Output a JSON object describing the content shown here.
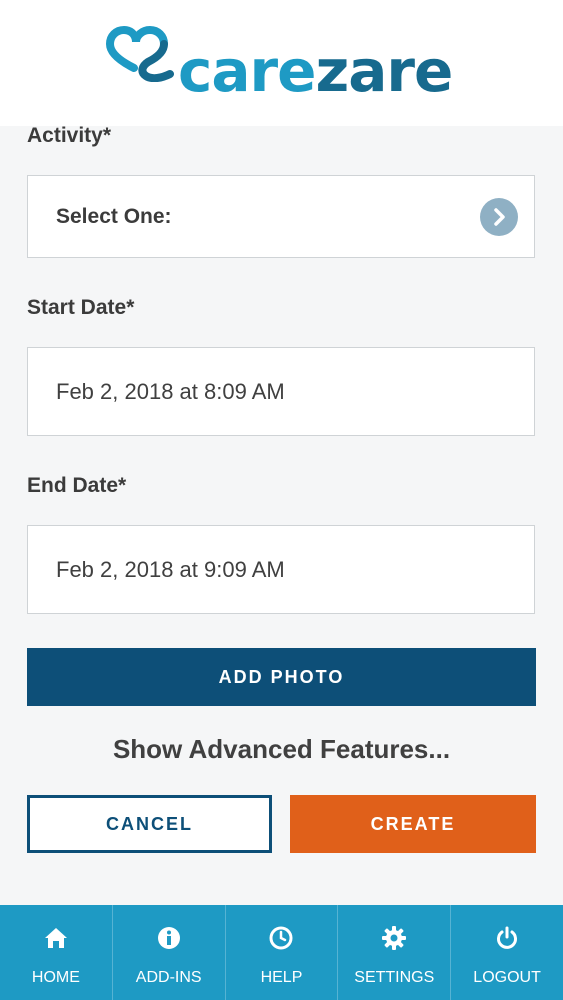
{
  "brand": {
    "name_part1": "care",
    "name_part2": "zare"
  },
  "form": {
    "activity_label": "Activity*",
    "activity_value": "Select One:",
    "start_label": "Start Date*",
    "start_value": "Feb 2, 2018 at 8:09 AM",
    "end_label": "End Date*",
    "end_value": "Feb 2, 2018 at 9:09 AM"
  },
  "actions": {
    "add_photo": "ADD PHOTO",
    "advanced": "Show Advanced Features...",
    "cancel": "CANCEL",
    "create": "CREATE"
  },
  "tabs": [
    {
      "label": "HOME",
      "icon": "home-icon"
    },
    {
      "label": "ADD-INS",
      "icon": "info-icon"
    },
    {
      "label": "HELP",
      "icon": "clock-icon"
    },
    {
      "label": "SETTINGS",
      "icon": "gear-icon"
    },
    {
      "label": "LOGOUT",
      "icon": "power-icon"
    }
  ],
  "colors": {
    "primary": "#0d4f78",
    "accent": "#e0601a",
    "tabbar": "#1e9ac4",
    "logo_light": "#1e9ac4",
    "logo_dark": "#176a8e"
  }
}
